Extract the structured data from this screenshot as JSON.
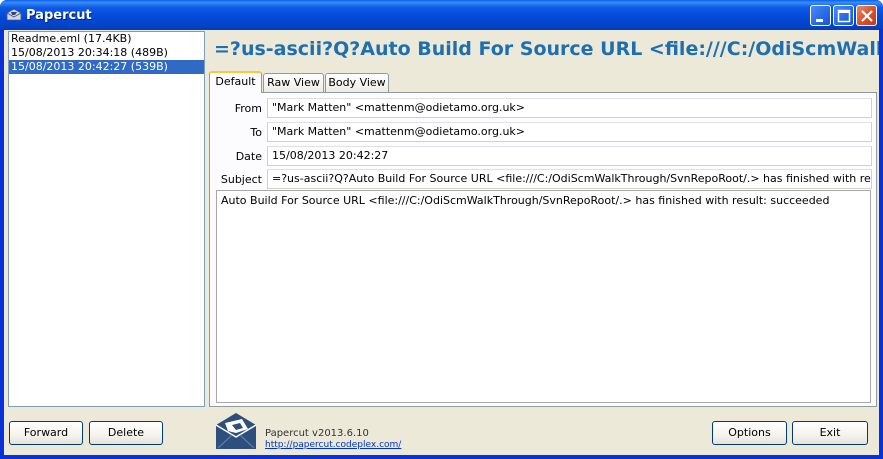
{
  "window": {
    "title": "Papercut"
  },
  "message_list": {
    "items": [
      {
        "label": "Readme.eml (17.4KB)",
        "selected": false
      },
      {
        "label": "15/08/2013 20:34:18 (489B)",
        "selected": false
      },
      {
        "label": "15/08/2013 20:42:27 (539B)",
        "selected": true
      }
    ]
  },
  "header": {
    "subject_title": "=?us-ascii?Q?Auto Build For Source URL <file:///C:/OdiScmWalkThrough/SvnRepoRoot/.> has finished with result: succeeded"
  },
  "tabs": [
    {
      "label": "Default",
      "active": true
    },
    {
      "label": "Raw View",
      "active": false
    },
    {
      "label": "Body View",
      "active": false
    }
  ],
  "fields": {
    "from_label": "From",
    "from_value": "\"Mark Matten\" <mattenm@odietamo.org.uk>",
    "to_label": "To",
    "to_value": "\"Mark Matten\" <mattenm@odietamo.org.uk>",
    "date_label": "Date",
    "date_value": "15/08/2013 20:42:27",
    "subject_label": "Subject",
    "subject_value": "=?us-ascii?Q?Auto Build For Source URL <file:///C:/OdiScmWalkThrough/SvnRepoRoot/.> has finished with result: succeeded"
  },
  "body_text": "Auto Build For Source URL <file:///C:/OdiScmWalkThrough/SvnRepoRoot/.> has finished with result: succeeded",
  "buttons": {
    "forward": "Forward",
    "delete": "Delete",
    "options": "Options",
    "exit": "Exit"
  },
  "footer": {
    "version": "Papercut v2013.6.10",
    "link": "http://papercut.codeplex.com/"
  },
  "colors": {
    "titlebar": "#0348d6",
    "selection": "#316ac5",
    "subject_header": "#1e6fb0",
    "link": "#0033cc"
  }
}
